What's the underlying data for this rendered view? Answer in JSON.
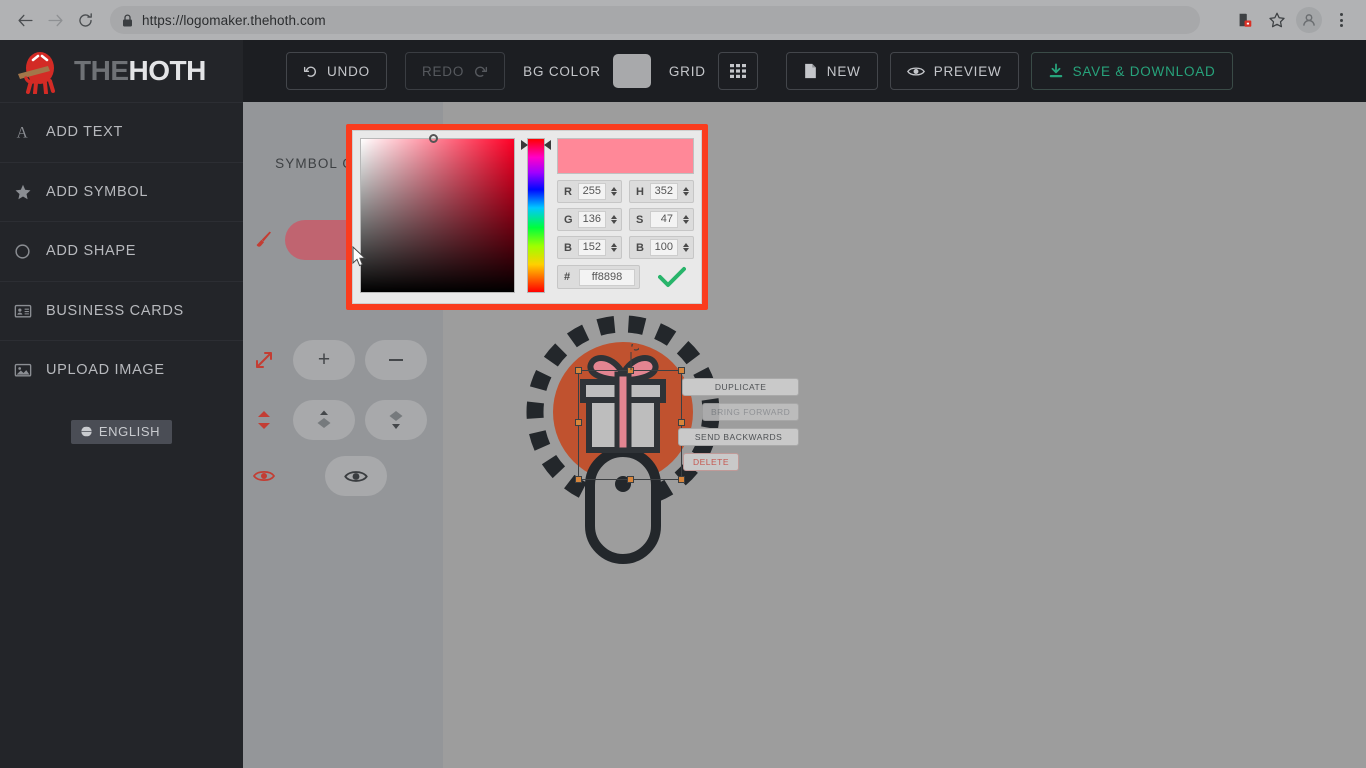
{
  "browser": {
    "back_icon": "back-arrow-icon",
    "forward_icon": "forward-arrow-icon",
    "reload_icon": "reload-icon",
    "lock_icon": "lock-icon",
    "url": "https://logomaker.thehoth.com",
    "extension_icon": "extension-icon",
    "bookmark_icon": "star-icon",
    "profile_icon": "profile-avatar-icon",
    "menu_icon": "kebab-menu-icon"
  },
  "sidebar": {
    "brand": {
      "part1": "THE",
      "part2": "HOTH",
      "mascot_icon": "hoth-mascot-logo"
    },
    "items": [
      {
        "label": "ADD TEXT",
        "icon": "text-a-icon"
      },
      {
        "label": "ADD SYMBOL",
        "icon": "star-icon"
      },
      {
        "label": "ADD SHAPE",
        "icon": "circle-outline-icon"
      },
      {
        "label": "BUSINESS CARDS",
        "icon": "business-card-icon"
      },
      {
        "label": "UPLOAD IMAGE",
        "icon": "image-upload-icon"
      }
    ],
    "language": {
      "label": "ENGLISH",
      "icon": "globe-icon"
    }
  },
  "toolbar": {
    "undo": {
      "label": "UNDO",
      "icon": "undo-arrow-icon",
      "enabled": true
    },
    "redo": {
      "label": "REDO",
      "icon": "redo-arrow-icon",
      "enabled": false
    },
    "bg_color": {
      "label": "BG COLOR",
      "swatch_color": "#a8a9ab"
    },
    "grid": {
      "label": "GRID",
      "icon": "grid-icon"
    },
    "new": {
      "label": "NEW",
      "icon": "document-icon"
    },
    "preview": {
      "label": "PREVIEW",
      "icon": "eye-icon"
    },
    "save": {
      "label": "SAVE & DOWNLOAD",
      "icon": "download-icon",
      "color": "#27a37b"
    }
  },
  "options_panel": {
    "title": "SYMBOL OPTIONS",
    "rows": [
      {
        "icon": "paint-brush-icon",
        "control": "color-swatch-pill",
        "swatch_color": "#c06470"
      },
      {
        "icon": "resize-arrows-icon",
        "control": "plus-button",
        "label": "+"
      },
      {
        "icon": "layer-order-icon",
        "control": "move-up-down-buttons"
      },
      {
        "icon": "eye-icon",
        "control": "visibility-toggle"
      }
    ]
  },
  "canvas": {
    "background_color": "#9d9d9d",
    "logo": {
      "circle_color": "#c0522f",
      "dashed_ring_color": "#23272b",
      "gift_icon": "gift-box-icon",
      "gift_ribbon_color": "#e38591",
      "mouse_icon": "computer-mouse-icon",
      "outline_color": "#23272b"
    },
    "context_menu": [
      {
        "label": "DUPLICATE",
        "enabled": true
      },
      {
        "label": "BRING FORWARD",
        "enabled": false
      },
      {
        "label": "SEND BACKWARDS",
        "enabled": true
      },
      {
        "label": "DELETE",
        "enabled": true,
        "danger": true
      }
    ]
  },
  "color_picker": {
    "highlight_border": "#fa3c1e",
    "preview_color": "#ff8898",
    "fields": [
      {
        "label": "R",
        "value": "255"
      },
      {
        "label": "H",
        "value": "352"
      },
      {
        "label": "G",
        "value": "136"
      },
      {
        "label": "S",
        "value": "47"
      },
      {
        "label": "B",
        "value": "152"
      },
      {
        "label": "B",
        "value": "100"
      }
    ],
    "hex": {
      "label": "#",
      "value": "ff8898"
    },
    "confirm_icon": "green-check-icon"
  }
}
